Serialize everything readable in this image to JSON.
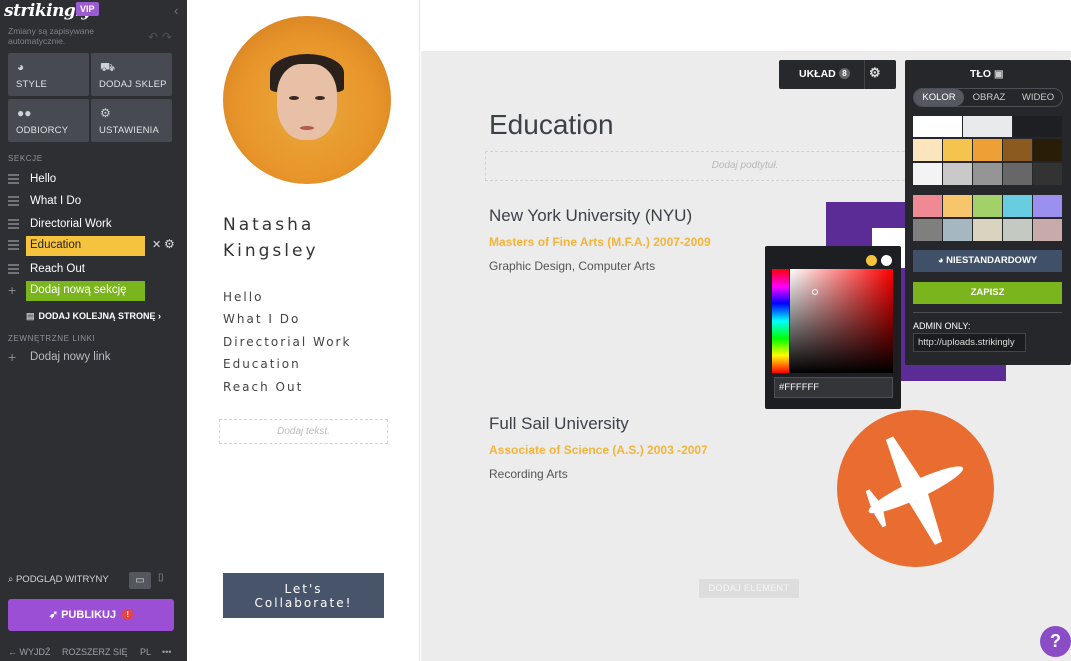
{
  "editor": {
    "brand": "strikingly",
    "vip_badge": "VIP",
    "autosave_note": "Zmiany są zapisywane automatycznie.",
    "tools": [
      {
        "label": "STYLE",
        "icon": "palette-icon"
      },
      {
        "label": "DODAJ SKLEP",
        "icon": "shop-bag-icon"
      },
      {
        "label": "ODBIORCY",
        "icon": "users-icon"
      },
      {
        "label": "USTAWIENIA",
        "icon": "gear-icon"
      }
    ],
    "sections_heading": "SEKCJE",
    "sections": [
      {
        "label": "Hello"
      },
      {
        "label": "What I Do"
      },
      {
        "label": "Directorial Work"
      },
      {
        "label": "Education",
        "active": true
      },
      {
        "label": "Reach Out"
      }
    ],
    "add_section": "Dodaj nową sekcję",
    "add_page": "DODAJ KOLEJNĄ STRONĘ",
    "external_links_heading": "ZEWNĘTRZNE LINKI",
    "add_link": "Dodaj nowy link",
    "preview": "PODGLĄD WITRYNY",
    "publish": "PUBLIKUJ",
    "publish_alert": "!",
    "footer": {
      "exit": "WYJDŹ",
      "expand": "ROZSZERZ SIĘ",
      "lang": "PL",
      "more": "•••"
    }
  },
  "site": {
    "person_name": [
      "Natasha",
      "Kingsley"
    ],
    "nav": [
      "Hello",
      "What I Do",
      "Directorial Work",
      "Education",
      "Reach Out"
    ],
    "add_text_placeholder": "Dodaj tekst.",
    "cta": [
      "Let's",
      "Collaborate!"
    ]
  },
  "section": {
    "title": "Education",
    "subtitle_placeholder": "Dodaj podtytuł.",
    "entries": [
      {
        "school": "New York University (NYU)",
        "degree": "Masters of Fine Arts (M.F.A.) 2007-2009",
        "field": "Graphic Design, Computer Arts"
      },
      {
        "school": "Full Sail University",
        "degree": "Associate of Science (A.S.) 2003 -2007",
        "field": "Recording Arts"
      }
    ],
    "add_element": "DODAJ ELEMENT",
    "layout_button": "UKŁAD",
    "layout_count": "8"
  },
  "background_panel": {
    "title": "TŁO",
    "tabs": [
      "KOLOR",
      "OBRAZ",
      "WIDEO"
    ],
    "active_tab": "KOLOR",
    "swatches_row1": [
      "#ffffff",
      "#e9eaec",
      "#1e1f22"
    ],
    "swatches_grid_a": [
      [
        "#fce4bd",
        "#f5c44e",
        "#ee9f35",
        "#8b5a1e",
        "#2a1d08"
      ],
      [
        "#f3f3f3",
        "#c9c9c9",
        "#959595",
        "#676767",
        "#333333"
      ]
    ],
    "swatches_grid_b": [
      [
        "#ef8a94",
        "#f8c66a",
        "#a3d169",
        "#68cde0",
        "#9b8ff0"
      ],
      [
        "#7f7f7f",
        "#a5b7c1",
        "#d9d3c0",
        "#c4c9c1",
        "#c9aaaa"
      ]
    ],
    "custom_button": "NIESTANDARDOWY",
    "save_button": "ZAPISZ",
    "admin_label": "ADMIN ONLY:",
    "admin_url": "http://uploads.strikingly"
  },
  "color_picker": {
    "hex_value": "#FFFFFF",
    "recent_colors": [
      "#f5c33d",
      "#ffffff"
    ]
  },
  "help": "?"
}
